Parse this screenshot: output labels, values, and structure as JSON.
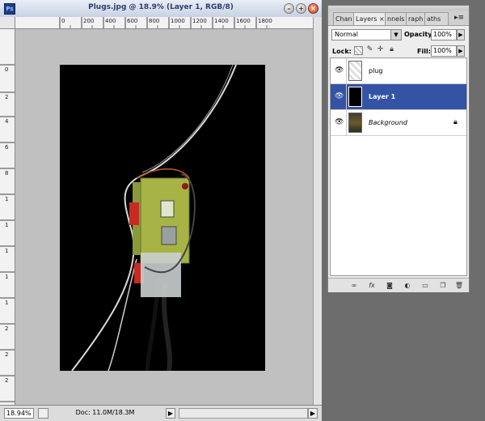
{
  "document": {
    "title": "Plugs.jpg @ 18.9% (Layer 1, RGB/8)",
    "app_icon": "Ps",
    "ruler_h_labels": [
      "0",
      "200",
      "400",
      "600",
      "800",
      "1000",
      "1200",
      "1400",
      "1600",
      "1800"
    ],
    "ruler_v_labels": [
      "0",
      "2",
      "4",
      "6",
      "8",
      "1",
      "1",
      "1",
      "1",
      "1",
      "2",
      "2",
      "2",
      "2"
    ],
    "status": {
      "zoom": "18.94%",
      "doc_size": "Doc: 11.0M/18.3M"
    }
  },
  "layers_panel": {
    "tabs": [
      "Chan",
      "Layers ×",
      "nnels",
      "raph",
      "aths"
    ],
    "blend_mode": "Normal",
    "opacity_label": "Opacity:",
    "opacity_value": "100%",
    "lock_label": "Lock:",
    "fill_label": "Fill:",
    "fill_value": "100%",
    "layers": [
      {
        "name": "plug",
        "visible": true,
        "selected": false
      },
      {
        "name": "Layer 1",
        "visible": true,
        "selected": true
      },
      {
        "name": "Background",
        "visible": true,
        "selected": false,
        "locked": true
      }
    ],
    "footer_icons": [
      "link-icon",
      "fx-icon",
      "mask-icon",
      "adjustment-icon",
      "group-icon",
      "new-layer-icon",
      "trash-icon"
    ]
  },
  "colors": {
    "selected_layer": "#3553a4",
    "canvas_bg": "#c0c0c0",
    "desktop_bg": "#6d6d6d"
  }
}
